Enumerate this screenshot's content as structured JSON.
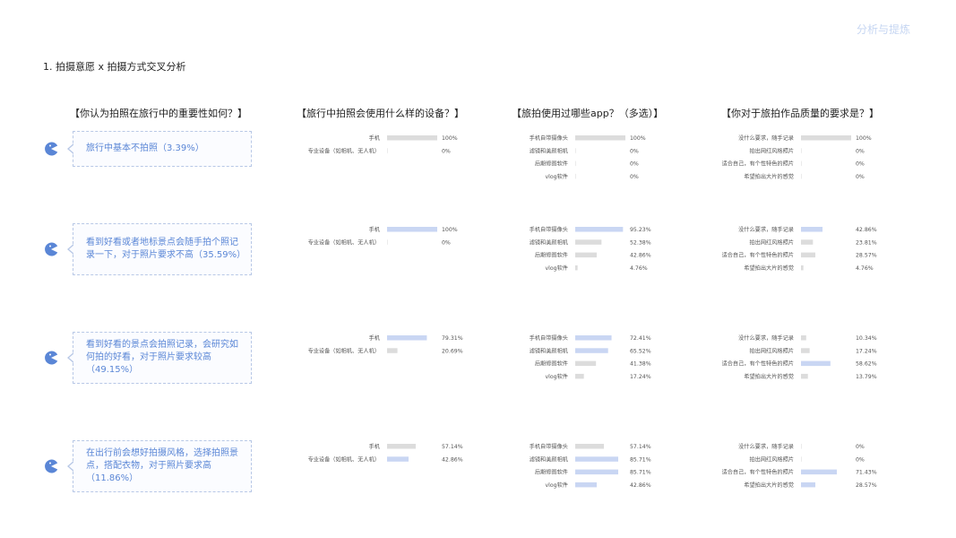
{
  "header": {
    "top_link": "分析与提炼"
  },
  "section_title": "1. 拍摄意愿 x 拍摄方式交叉分析",
  "columns": [
    {
      "title": "【你认为拍照在旅行中的重要性如何？】"
    },
    {
      "title": "【旅行中拍照会使用什么样的设备？】"
    },
    {
      "title": "【旅拍使用过哪些app？（多选）】"
    },
    {
      "title": "【你对于旅拍作品质量的要求是？】"
    }
  ],
  "rows": [
    {
      "label": "旅行中基本不拍照（3.39%）"
    },
    {
      "label": "看到好看或者地标景点会随手拍个照记录一下，对于照片要求不高（35.59%）"
    },
    {
      "label": "看到好看的景点会拍照记录，会研究如何拍的好看，对于照片要求较高（49.15%）"
    },
    {
      "label": "在出行前会想好拍摄风格，选择拍照景点，搭配衣物，对于照片要求高（11.86%）"
    }
  ],
  "colors": {
    "gray": "#dcdcdc",
    "blue": "#c9d6f3",
    "accent": "#5a86d6"
  },
  "icon": "pacman-icon",
  "chart_data": [
    {
      "type": "bar",
      "row": 0,
      "question": "device",
      "categories": [
        "手机",
        "专业设备（如相机、无人机）"
      ],
      "values": [
        100,
        0
      ],
      "value_labels": [
        "100%",
        "0%"
      ],
      "color": "gray"
    },
    {
      "type": "bar",
      "row": 0,
      "question": "app",
      "categories": [
        "手机自带摄像头",
        "滤镜和美颜相机",
        "后期修图软件",
        "vlog软件"
      ],
      "values": [
        100,
        0,
        0,
        0
      ],
      "value_labels": [
        "100%",
        "0%",
        "0%",
        "0%"
      ],
      "color": "gray"
    },
    {
      "type": "bar",
      "row": 0,
      "question": "quality",
      "categories": [
        "没什么要求，随手记录",
        "拍出网红风格照片",
        "适合自己，有个性特色的照片",
        "希望拍出大片的感觉"
      ],
      "values": [
        100,
        0,
        0,
        0
      ],
      "value_labels": [
        "100%",
        "0%",
        "0%",
        "0%"
      ],
      "color": "gray"
    },
    {
      "type": "bar",
      "row": 1,
      "question": "device",
      "categories": [
        "手机",
        "专业设备（如相机、无人机）"
      ],
      "values": [
        100,
        0
      ],
      "value_labels": [
        "100%",
        "0%"
      ],
      "color": "blue"
    },
    {
      "type": "bar",
      "row": 1,
      "question": "app",
      "categories": [
        "手机自带摄像头",
        "滤镜和美颜相机",
        "后期修图软件",
        "vlog软件"
      ],
      "values": [
        95.23,
        52.38,
        42.86,
        4.76
      ],
      "value_labels": [
        "95.23%",
        "52.38%",
        "42.86%",
        "4.76%"
      ],
      "color": "mixed"
    },
    {
      "type": "bar",
      "row": 1,
      "question": "quality",
      "categories": [
        "没什么要求，随手记录",
        "拍出网红风格照片",
        "适合自己，有个性特色的照片",
        "希望拍出大片的感觉"
      ],
      "values": [
        42.86,
        23.81,
        28.57,
        4.76
      ],
      "value_labels": [
        "42.86%",
        "23.81%",
        "28.57%",
        "4.76%"
      ],
      "color": "mixed"
    },
    {
      "type": "bar",
      "row": 2,
      "question": "device",
      "categories": [
        "手机",
        "专业设备（如相机、无人机）"
      ],
      "values": [
        79.31,
        20.69
      ],
      "value_labels": [
        "79.31%",
        "20.69%"
      ],
      "color": "mixed"
    },
    {
      "type": "bar",
      "row": 2,
      "question": "app",
      "categories": [
        "手机自带摄像头",
        "滤镜和美颜相机",
        "后期修图软件",
        "vlog软件"
      ],
      "values": [
        72.41,
        65.52,
        41.38,
        17.24
      ],
      "value_labels": [
        "72.41%",
        "65.52%",
        "41.38%",
        "17.24%"
      ],
      "color": "mixed"
    },
    {
      "type": "bar",
      "row": 2,
      "question": "quality",
      "categories": [
        "没什么要求，随手记录",
        "拍出网红风格照片",
        "适合自己，有个性特色的照片",
        "希望拍出大片的感觉"
      ],
      "values": [
        10.34,
        17.24,
        58.62,
        13.79
      ],
      "value_labels": [
        "10.34%",
        "17.24%",
        "58.62%",
        "13.79%"
      ],
      "color": "mixed"
    },
    {
      "type": "bar",
      "row": 3,
      "question": "device",
      "categories": [
        "手机",
        "专业设备（如相机、无人机）"
      ],
      "values": [
        57.14,
        42.86
      ],
      "value_labels": [
        "57.14%",
        "42.86%"
      ],
      "color": "mixed"
    },
    {
      "type": "bar",
      "row": 3,
      "question": "app",
      "categories": [
        "手机自带摄像头",
        "滤镜和美颜相机",
        "后期修图软件",
        "vlog软件"
      ],
      "values": [
        57.14,
        85.71,
        85.71,
        42.86
      ],
      "value_labels": [
        "57.14%",
        "85.71%",
        "85.71%",
        "42.86%"
      ],
      "color": "mixed"
    },
    {
      "type": "bar",
      "row": 3,
      "question": "quality",
      "categories": [
        "没什么要求，随手记录",
        "拍出网红风格照片",
        "适合自己，有个性特色的照片",
        "希望拍出大片的感觉"
      ],
      "values": [
        0,
        0,
        71.43,
        28.57
      ],
      "value_labels": [
        "0%",
        "0%",
        "71.43%",
        "28.57%"
      ],
      "color": "mixed"
    }
  ],
  "bar_colors": {
    "1-app": [
      "blue",
      "gray",
      "gray",
      "gray"
    ],
    "1-quality": [
      "blue",
      "gray",
      "gray",
      "gray"
    ],
    "2-device": [
      "blue",
      "gray"
    ],
    "2-app": [
      "blue",
      "blue",
      "gray",
      "gray"
    ],
    "2-quality": [
      "gray",
      "gray",
      "blue",
      "gray"
    ],
    "3-device": [
      "gray",
      "blue"
    ],
    "3-app": [
      "gray",
      "blue",
      "blue",
      "blue"
    ],
    "3-quality": [
      "gray",
      "gray",
      "blue",
      "blue"
    ]
  }
}
